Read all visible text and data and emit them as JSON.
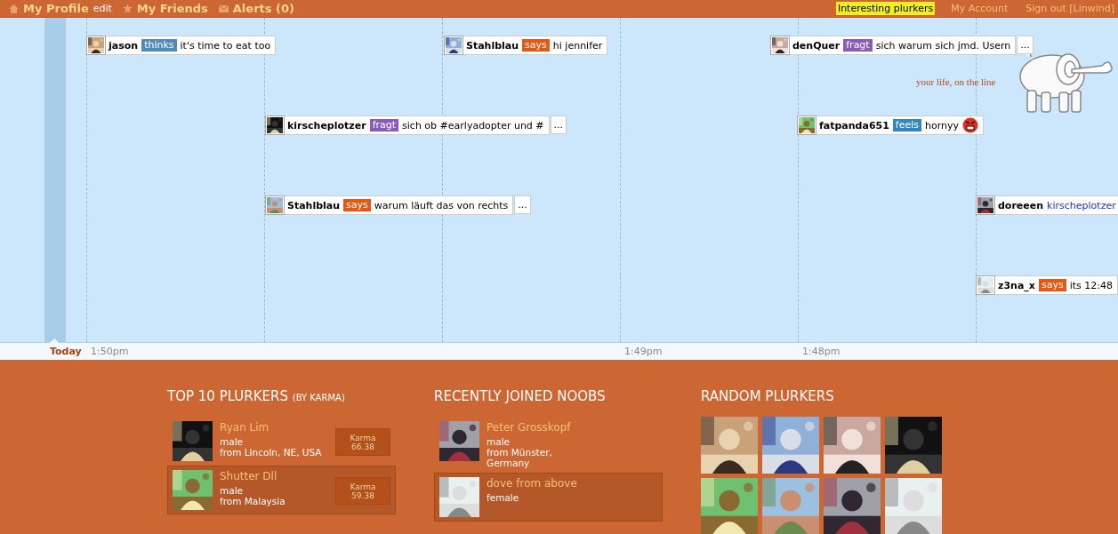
{
  "nav": {
    "left": [
      {
        "kind": "home",
        "label": "My Profile",
        "extra": "edit"
      },
      {
        "kind": "star",
        "label": "My Friends"
      },
      {
        "kind": "mail",
        "label": "Alerts (0)"
      }
    ],
    "right": [
      {
        "label": "Interesting plurkers",
        "selected": true
      },
      {
        "label": "My Account",
        "selected": false
      },
      {
        "label": "Sign out [Linwind]",
        "selected": false
      }
    ]
  },
  "logo": {
    "tagline": "your life, on the line"
  },
  "plurks": [
    {
      "user": "jason",
      "qualifier": {
        "text": "thinks",
        "color": "#4f8ab8"
      },
      "content": "it's time to eat too"
    },
    {
      "user": "Stahlblau",
      "qualifier": {
        "text": "says",
        "color": "#e05a14"
      },
      "content": "hi jennifer"
    },
    {
      "user": "denQuer",
      "qualifier": {
        "text": "fragt",
        "color": "#8a5cb8"
      },
      "content": "sich warum sich jmd. Usern",
      "more": "..."
    },
    {
      "user": "kirscheplotzer",
      "qualifier": {
        "text": "fragt",
        "color": "#8a5cb8"
      },
      "content": "sich ob #earlyadopter und #",
      "more": "..."
    },
    {
      "user": "fatpanda651",
      "qualifier": {
        "text": "feels",
        "color": "#2f86c0"
      },
      "content": "hornyy",
      "emoticon": true
    },
    {
      "user": "Stahlblau",
      "qualifier": {
        "text": "says",
        "color": "#e05a14"
      },
      "content": "warum läuft das von rechts",
      "more": "..."
    },
    {
      "user": "doreeen",
      "content": "kirscheplotzer",
      "mention": true
    },
    {
      "user": "z3na_x",
      "qualifier": {
        "text": "says",
        "color": "#e05a14"
      },
      "content": "its 12:48"
    }
  ],
  "timeline": {
    "today": "Today",
    "ticks": [
      "1:50pm",
      "1:49pm",
      "1:48pm"
    ]
  },
  "top_plurkers": {
    "title": "TOP 10 PLURKERS",
    "subtitle": "(BY KARMA)",
    "rows": [
      {
        "name": "Ryan Lim",
        "gender": "male",
        "location": "from Lincoln, NE, USA",
        "karma_label": "Karma",
        "karma": "66.38",
        "highlighted": false
      },
      {
        "name": "Shutter Dll",
        "gender": "male",
        "location": "from Malaysia",
        "karma_label": "Karma",
        "karma": "59.38",
        "highlighted": true
      }
    ]
  },
  "recent_noobs": {
    "title": "RECENTLY JOINED NOOBS",
    "rows": [
      {
        "name": "Peter Grosskopf",
        "gender": "male",
        "location": "from Münster, Germany",
        "highlighted": false
      },
      {
        "name": "dove from above",
        "gender": "female",
        "highlighted": true
      }
    ]
  },
  "random_plurkers": {
    "title": "RANDOM PLURKERS"
  }
}
